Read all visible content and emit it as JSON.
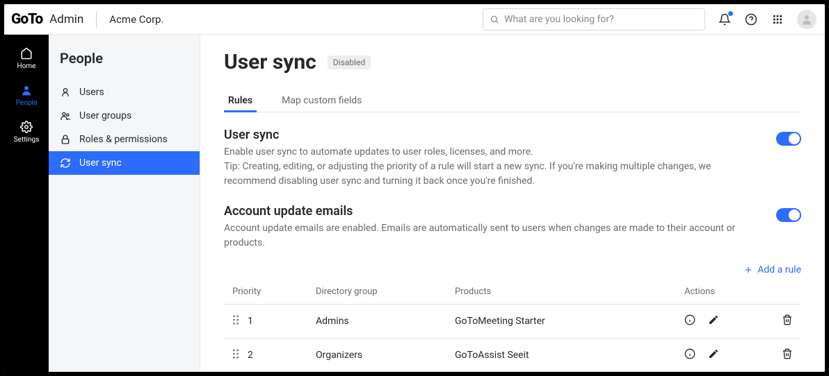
{
  "header": {
    "logo_text": "GoTo",
    "admin_label": "Admin",
    "org_name": "Acme Corp.",
    "search_placeholder": "What are you looking for?"
  },
  "nav": {
    "items": [
      {
        "label": "Home"
      },
      {
        "label": "People"
      },
      {
        "label": "Settings"
      }
    ]
  },
  "sidebar": {
    "title": "People",
    "items": [
      {
        "label": "Users"
      },
      {
        "label": "User groups"
      },
      {
        "label": "Roles & permissions"
      },
      {
        "label": "User sync"
      }
    ]
  },
  "page": {
    "title": "User sync",
    "status": "Disabled",
    "tabs": [
      {
        "label": "Rules"
      },
      {
        "label": "Map custom fields"
      }
    ],
    "sections": {
      "sync": {
        "title": "User sync",
        "desc1": "Enable user sync to automate updates to user roles, licenses, and more.",
        "desc2": "Tip: Creating, editing, or adjusting the priority of a rule will start a new sync. If you're making multiple changes, we recommend disabling user sync and turning it back once you're finished."
      },
      "emails": {
        "title": "Account update emails",
        "desc": "Account update emails are enabled. Emails are automatically sent to users when changes are made to their account or products."
      }
    },
    "add_rule_label": "Add a rule",
    "table": {
      "headers": {
        "priority": "Priority",
        "directory_group": "Directory group",
        "products": "Products",
        "actions": "Actions"
      },
      "rows": [
        {
          "priority": "1",
          "group": "Admins",
          "products": "GoToMeeting Starter"
        },
        {
          "priority": "2",
          "group": "Organizers",
          "products": "GoToAssist Seeit"
        }
      ]
    }
  }
}
